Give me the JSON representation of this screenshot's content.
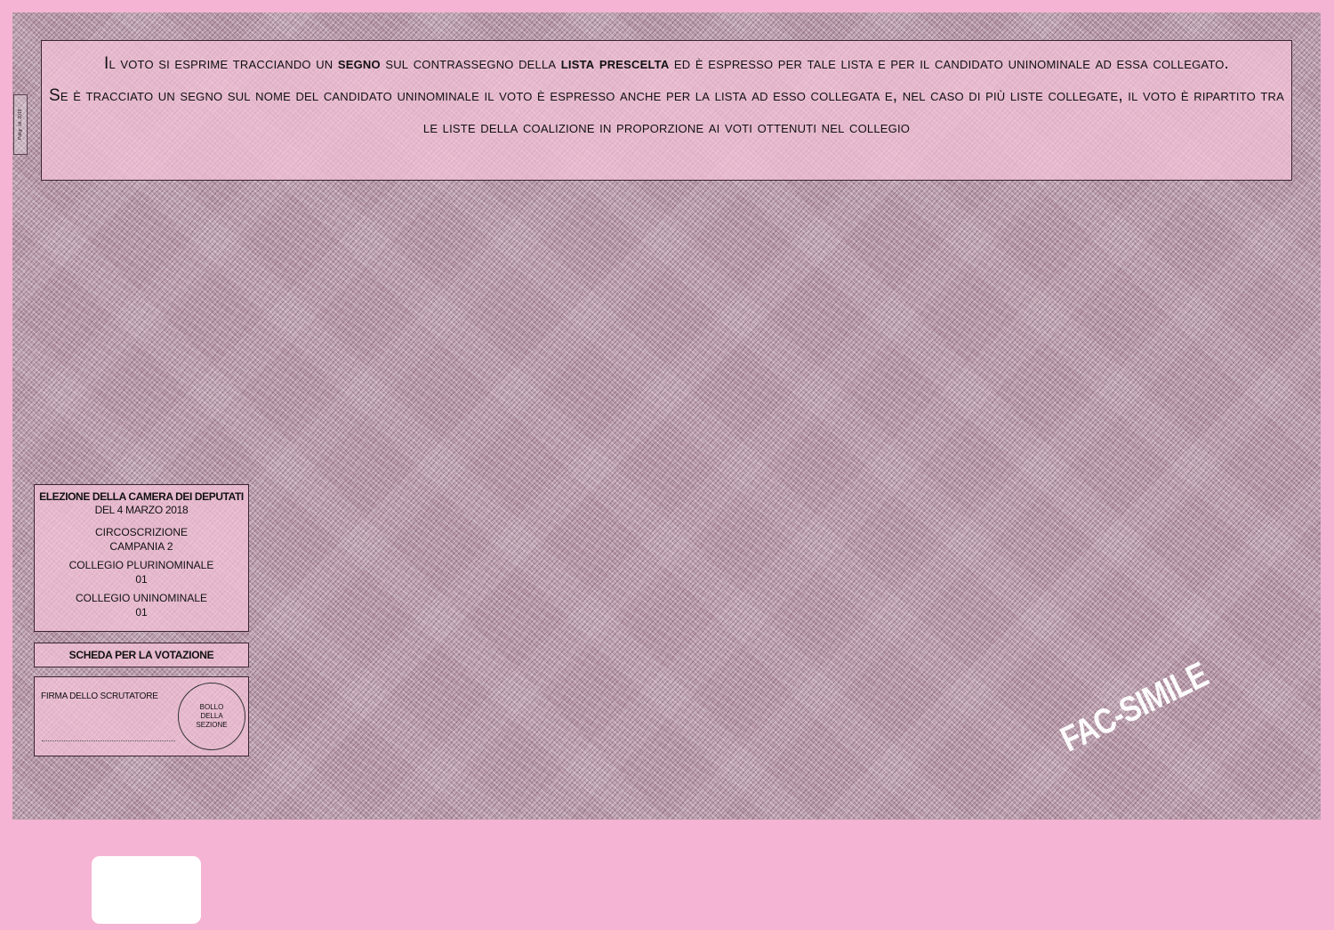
{
  "side_code": "Poligr. Ist. 2018",
  "instructions": {
    "line1_a": "Il voto si esprime tracciando un ",
    "line1_b": "segno",
    "line1_c": " sul contrassegno della ",
    "line1_d": "lista prescelta",
    "line1_e": " ed è espresso per tale lista e per il candidato uninominale ad essa collegato.",
    "line2": "Se è tracciato un segno sul nome del candidato uninominale il voto è espresso anche per la lista ad esso collegata e, nel caso di più liste collegate, il voto è ripartito tra le liste della coalizione in proporzione ai voti ottenuti nel collegio"
  },
  "header": {
    "title": "ELEZIONE DELLA CAMERA DEI DEPUTATI",
    "date": "DEL 4 MARZO 2018",
    "circ_label": "CIRCOSCRIZIONE",
    "circ_value": "CAMPANIA 2",
    "pluri_label": "COLLEGIO PLURINOMINALE",
    "pluri_value": "01",
    "uni_label": "COLLEGIO UNINOMINALE",
    "uni_value": "01"
  },
  "ballot_title": "SCHEDA PER LA VOTAZIONE",
  "signature": {
    "label": "FIRMA DELLO SCRUTATORE",
    "stamp_line1": "BOLLO",
    "stamp_line2": "DELLA",
    "stamp_line3": "SEZIONE"
  },
  "watermark": "FAC-SIMILE",
  "colors": {
    "page_background": "#f5b4d3",
    "ballot_pattern": "#b899a9",
    "panel_fill": "#f7c4da",
    "watermark": "#ffffff"
  }
}
